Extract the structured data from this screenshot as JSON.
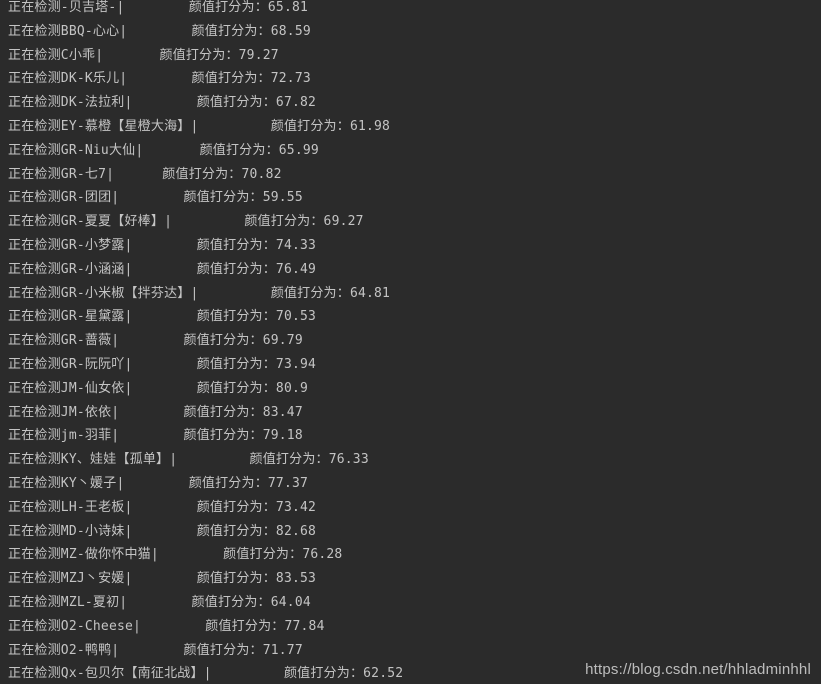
{
  "console": {
    "lines": [
      "正在检测-贝吉塔-|        颜值打分为：65.81",
      "正在检测BBQ-心心|        颜值打分为：68.59",
      "正在检测C小乖|       颜值打分为：79.27",
      "正在检测DK-K乐儿|        颜值打分为：72.73",
      "正在检测DK-法拉利|        颜值打分为：67.82",
      "正在检测EY-慕橙【星橙大海】|         颜值打分为：61.98",
      "正在检测GR-Niu大仙|       颜值打分为：65.99",
      "正在检测GR-七7|      颜值打分为：70.82",
      "正在检测GR-团团|        颜值打分为：59.55",
      "正在检测GR-夏夏【好棒】|         颜值打分为：69.27",
      "正在检测GR-小梦露|        颜值打分为：74.33",
      "正在检测GR-小涵涵|        颜值打分为：76.49",
      "正在检测GR-小米椒【拌芬达】|         颜值打分为：64.81",
      "正在检测GR-星黛露|        颜值打分为：70.53",
      "正在检测GR-蔷薇|        颜值打分为：69.79",
      "正在检测GR-阮阮吖|        颜值打分为：73.94",
      "正在检测JM-仙女依|        颜值打分为：80.9",
      "正在检测JM-依依|        颜值打分为：83.47",
      "正在检测jm-羽菲|        颜值打分为：79.18",
      "正在检测KY、娃娃【孤单】|         颜值打分为：76.33",
      "正在检测KY丶媛子|        颜值打分为：77.37",
      "正在检测LH-王老板|        颜值打分为：73.42",
      "正在检测MD-小诗妹|        颜值打分为：82.68",
      "正在检测MZ-做你怀中猫|        颜值打分为：76.28",
      "正在检测MZJ丶安媛|        颜值打分为：83.53",
      "正在检测MZL-夏初|        颜值打分为：64.04",
      "正在检测O2-Cheese|        颜值打分为：77.84",
      "正在检测O2-鸭鸭|        颜值打分为：71.77",
      "正在检测Qx-包贝尔【南征北战】|         颜值打分为：62.52"
    ]
  },
  "watermark": "https://blog.csdn.net/hhladminhhl"
}
